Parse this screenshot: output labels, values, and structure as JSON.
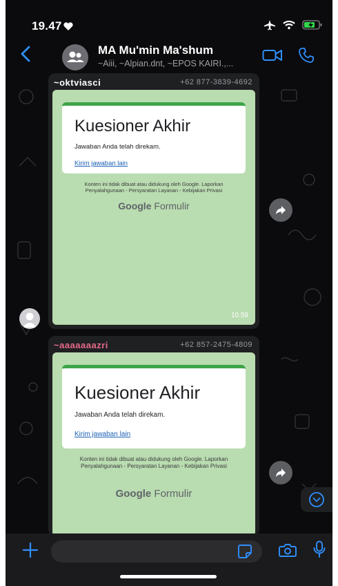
{
  "status_bar": {
    "time": "19.47"
  },
  "chat": {
    "title": "MA Mu'min Ma'shum",
    "subtitle": "~Aiii, ~Alpian.dnt, ~EPOS KAIRI.,..."
  },
  "messages": [
    {
      "sender": "~oktviasci",
      "sender_color": "#ffffff",
      "phone": "+62 877-3839-4692",
      "form_title": "Kuesioner Akhir",
      "form_message": "Jawaban Anda telah direkam.",
      "form_link": "Kirim jawaban lain",
      "disclaimer": "Konten ini tidak dibuat atau didukung oleh Google. Laporkan Penyalahgunaan - Persyaratan Layanan - Kebijakan Privasi",
      "brand_bold": "Google",
      "brand_rest": "Formulir",
      "time": "10.59"
    },
    {
      "sender": "~aaaaaaazri",
      "sender_color": "#e86a8a",
      "phone": "+62 857-2475-4809",
      "form_title": "Kuesioner Akhir",
      "form_message": "Jawaban Anda telah direkam.",
      "form_link": "Kirim jawaban lain",
      "disclaimer": "Konten ini tidak dibuat atau didukung oleh Google. Laporkan Penyalahgunaan - Persyaratan Layanan - Kebijakan Privasi",
      "brand_bold": "Google",
      "brand_rest": "Formulir"
    }
  ],
  "colors": {
    "accent": "#2f8fff",
    "form_green": "#3da447",
    "bubble": "#1f2022"
  },
  "icons": [
    "heart-icon",
    "airplane-icon",
    "wifi-icon",
    "battery-icon",
    "back-chevron-icon",
    "group-icon",
    "video-call-icon",
    "voice-call-icon",
    "forward-icon",
    "chevron-down-icon",
    "plus-icon",
    "sticker-icon",
    "camera-icon",
    "microphone-icon"
  ]
}
